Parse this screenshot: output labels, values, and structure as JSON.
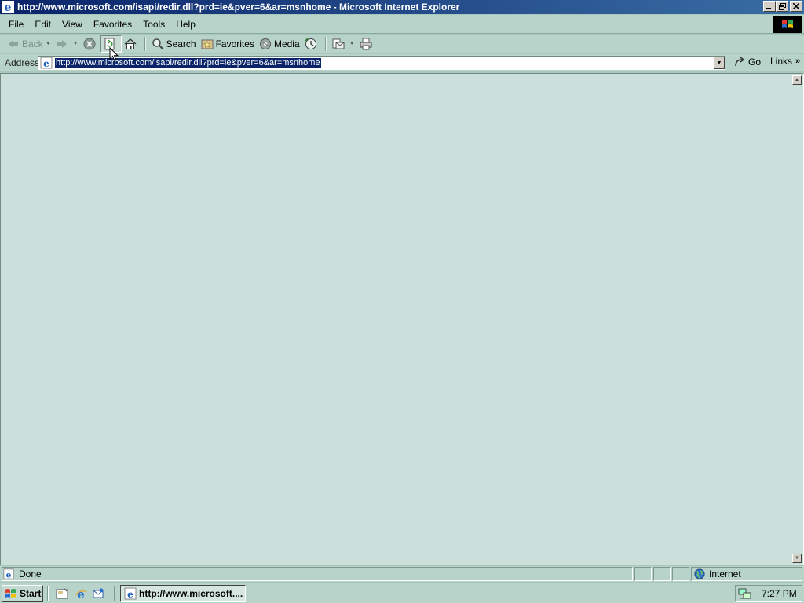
{
  "window": {
    "title": "http://www.microsoft.com/isapi/redir.dll?prd=ie&pver=6&ar=msnhome - Microsoft Internet Explorer",
    "minimize_icon": "minimize-icon",
    "restore_icon": "restore-icon",
    "close_icon": "close-icon"
  },
  "menubar": {
    "items": [
      "File",
      "Edit",
      "View",
      "Favorites",
      "Tools",
      "Help"
    ]
  },
  "toolbar": {
    "back_label": "Back",
    "search_label": "Search",
    "favorites_label": "Favorites",
    "media_label": "Media"
  },
  "address": {
    "label": "Address",
    "url": "http://www.microsoft.com/isapi/redir.dll?prd=ie&pver=6&ar=msnhome",
    "go_label": "Go",
    "links_label": "Links"
  },
  "status": {
    "text": "Done",
    "zone": "Internet"
  },
  "taskbar": {
    "start_label": "Start",
    "task_label": "http://www.microsoft....",
    "clock": "7:27 PM"
  },
  "colors": {
    "title_start": "#0a246a",
    "title_end": "#3a6ea5",
    "chrome": "#b8d3c9",
    "content": "#cbe0da"
  }
}
